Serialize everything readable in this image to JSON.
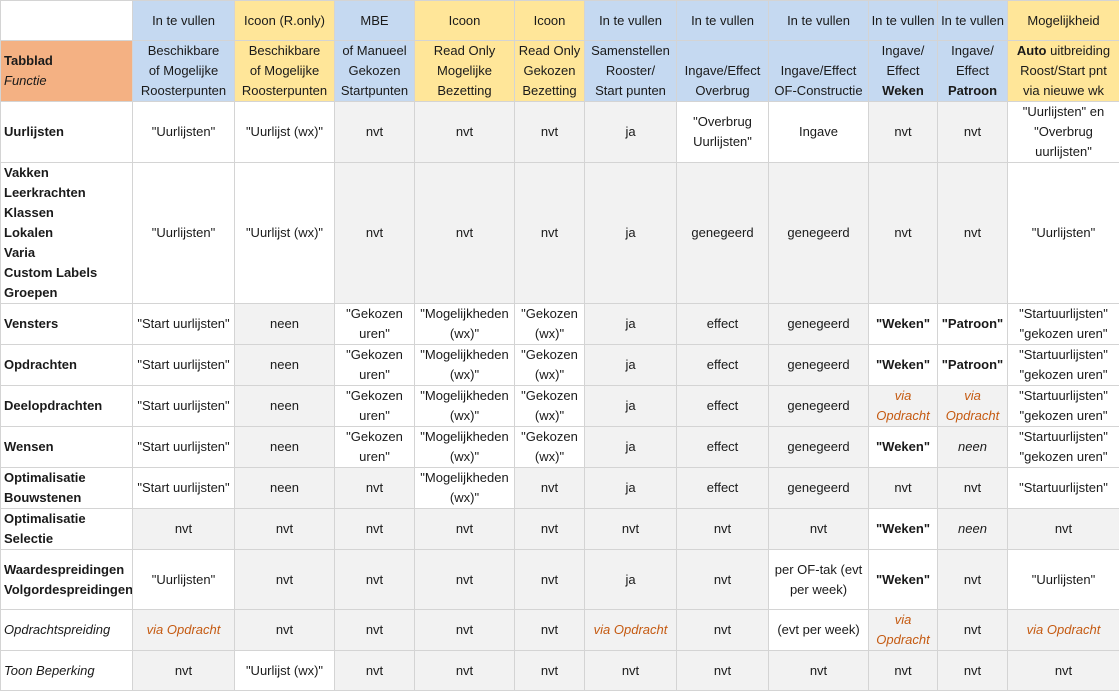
{
  "header": {
    "row1": [
      "In te vullen",
      "Icoon (R.only)",
      "MBE",
      "Icoon",
      "Icoon",
      "In te vullen",
      "In te vullen",
      "In te vullen",
      "In te vullen",
      "In te vullen",
      "Mogelijkheid"
    ],
    "tabblad": "Tabblad",
    "functie": "Functie",
    "cols": [
      [
        "Beschikbare",
        "of Mogelijke",
        "Roosterpunten"
      ],
      [
        "Beschikbare",
        "of Mogelijke",
        "Roosterpunten"
      ],
      [
        "of Manueel",
        "Gekozen",
        "Startpunten"
      ],
      [
        "Read Only",
        "Mogelijke",
        "Bezetting"
      ],
      [
        "Read Only",
        "Gekozen",
        "Bezetting"
      ],
      [
        "Samenstellen",
        "Rooster/",
        "Start punten"
      ],
      [
        "Ingave/Effect",
        "Overbrug"
      ],
      [
        "Ingave/Effect",
        "OF-Constructie"
      ],
      [
        "Ingave/",
        "Effect",
        "Weken"
      ],
      [
        "Ingave/",
        "Effect",
        "Patroon"
      ],
      [
        "Auto uitbreiding",
        "Roost/Start pnt",
        "via nieuwe wk"
      ]
    ],
    "vullen_line1": "vullen",
    "col11_auto": "Auto",
    "col11_uitbreiding": " uitbreiding"
  },
  "rows": [
    {
      "label": [
        "Uurlijsten"
      ],
      "cells": [
        "\"Uurlijsten\"",
        "\"Uurlijst (wx)\"",
        "nvt",
        "nvt",
        "nvt",
        "ja",
        "\"Overbrug Uurlijsten\"",
        "Ingave",
        "nvt",
        "nvt",
        "\"Uurlijsten\" en \"Overbrug uurlijsten\""
      ]
    },
    {
      "label": [
        "Vakken",
        "Leerkrachten",
        "Klassen",
        "Lokalen",
        "Varia",
        "Custom Labels",
        "Groepen"
      ],
      "cells": [
        "\"Uurlijsten\"",
        "\"Uurlijst (wx)\"",
        "nvt",
        "nvt",
        "nvt",
        "ja",
        "genegeerd",
        "genegeerd",
        "nvt",
        "nvt",
        "\"Uurlijsten\""
      ]
    },
    {
      "label": [
        "Vensters"
      ],
      "cells": [
        "\"Start uurlijsten\"",
        "neen",
        "\"Gekozen uren\"",
        "\"Mogelijkheden (wx)\"",
        "\"Gekozen (wx)\"",
        "ja",
        "effect",
        "genegeerd",
        "\"Weken\"",
        "\"Patroon\"",
        "\"Startuurlijsten\" \"gekozen uren\""
      ]
    },
    {
      "label": [
        "Opdrachten"
      ],
      "cells": [
        "\"Start uurlijsten\"",
        "neen",
        "\"Gekozen uren\"",
        "\"Mogelijkheden (wx)\"",
        "\"Gekozen (wx)\"",
        "ja",
        "effect",
        "genegeerd",
        "\"Weken\"",
        "\"Patroon\"",
        "\"Startuurlijsten\" \"gekozen uren\""
      ]
    },
    {
      "label": [
        "Deelopdrachten"
      ],
      "cells": [
        "\"Start uurlijsten\"",
        "neen",
        "\"Gekozen uren\"",
        "\"Mogelijkheden (wx)\"",
        "\"Gekozen (wx)\"",
        "ja",
        "effect",
        "genegeerd",
        "via Opdracht",
        "via Opdracht",
        "\"Startuurlijsten\" \"gekozen uren\""
      ]
    },
    {
      "label": [
        "Wensen"
      ],
      "cells": [
        "\"Start uurlijsten\"",
        "neen",
        "\"Gekozen uren\"",
        "\"Mogelijkheden (wx)\"",
        "\"Gekozen (wx)\"",
        "ja",
        "effect",
        "genegeerd",
        "\"Weken\"",
        "neen",
        "\"Startuurlijsten\" \"gekozen uren\""
      ]
    },
    {
      "label": [
        "Optimalisatie",
        "Bouwstenen"
      ],
      "cells": [
        "\"Start uurlijsten\"",
        "neen",
        "nvt",
        "\"Mogelijkheden (wx)\"",
        "nvt",
        "ja",
        "effect",
        "genegeerd",
        "nvt",
        "nvt",
        "\"Startuurlijsten\""
      ]
    },
    {
      "label": [
        "Optimalisatie",
        "Selectie"
      ],
      "cells": [
        "nvt",
        "nvt",
        "nvt",
        "nvt",
        "nvt",
        "nvt",
        "nvt",
        "nvt",
        "\"Weken\"",
        "neen",
        "nvt"
      ]
    },
    {
      "label": [
        "Waardespreidingen",
        "Volgordespreidingen"
      ],
      "cells": [
        "\"Uurlijsten\"",
        "nvt",
        "nvt",
        "nvt",
        "nvt",
        "ja",
        "nvt",
        "per OF-tak (evt per week)",
        "\"Weken\"",
        "nvt",
        "\"Uurlijsten\""
      ]
    },
    {
      "label": [
        "Opdrachtspreiding"
      ],
      "cells": [
        "via Opdracht",
        "nvt",
        "nvt",
        "nvt",
        "nvt",
        "via Opdracht",
        "nvt",
        "(evt per week)",
        "via Opdracht",
        "nvt",
        "via Opdracht"
      ]
    },
    {
      "label": [
        "Toon Beperking"
      ],
      "cells": [
        "nvt",
        "\"Uurlijst (wx)\"",
        "nvt",
        "nvt",
        "nvt",
        "nvt",
        "nvt",
        "nvt",
        "nvt",
        "nvt",
        "nvt"
      ]
    }
  ],
  "colors": {
    "blue": "#c5d9f1",
    "yellow": "#ffe699",
    "orange": "#f4b183",
    "gray": "#f2f2f2",
    "via": "#c55a11"
  }
}
